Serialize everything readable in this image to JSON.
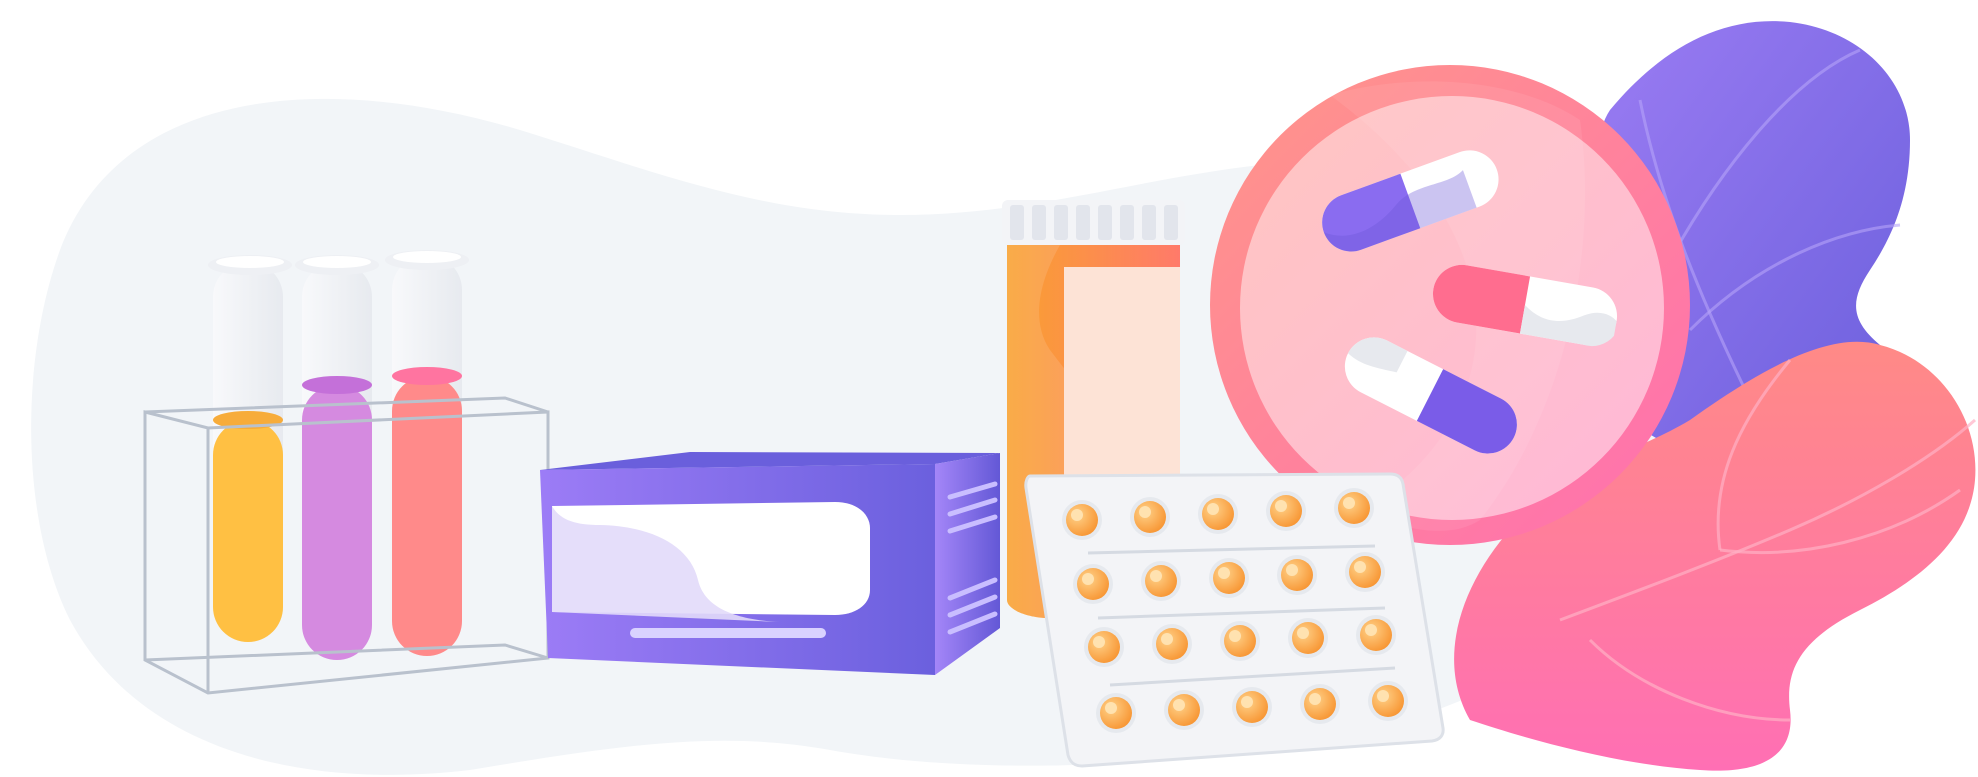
{
  "scene": {
    "subject": "pharmacy-illustration",
    "elements": [
      "test-tube-rack",
      "medicine-box",
      "pill-bottle",
      "capsule-bubble",
      "blister-pack",
      "decorative-leaves"
    ]
  },
  "test_tubes": [
    {
      "name": "yellow-tube",
      "liquid_color": "#ffc043",
      "level": 0.62
    },
    {
      "name": "purple-tube",
      "liquid_color": "#d58ae0",
      "level": 0.7
    },
    {
      "name": "red-tube",
      "liquid_color": "#ff8a8a",
      "level": 0.72
    }
  ],
  "capsules": [
    {
      "name": "purple-white-capsule",
      "color": "#8a6cf0"
    },
    {
      "name": "red-white-capsule",
      "color": "#ff6d8f"
    },
    {
      "name": "white-purple-capsule",
      "color": "#7a5ce8"
    }
  ],
  "blister_pack": {
    "rows": 4,
    "columns": 5,
    "pill_color": "#f9a347"
  },
  "colors": {
    "background_blob": "#f2f5f8",
    "purple": "#7b63e6",
    "purple_light": "#a187f5",
    "pink": "#ff7aa8",
    "orange": "#f9a13a",
    "rack_line": "#b9c1cd",
    "cap_white": "#f3f4f7"
  }
}
